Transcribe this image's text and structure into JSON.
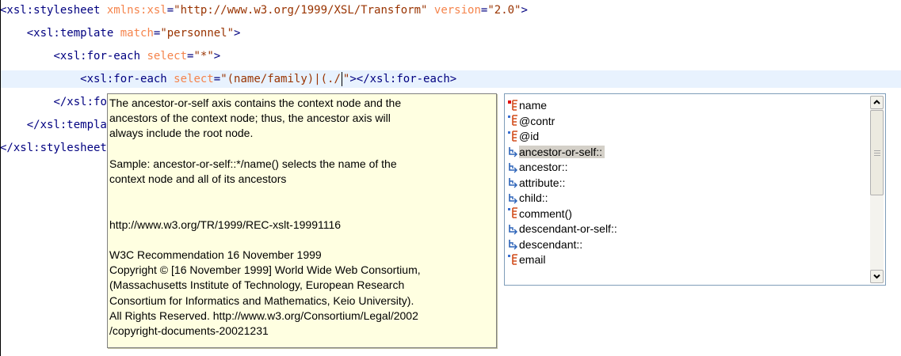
{
  "editor": {
    "lines": [
      {
        "indent": "",
        "tag_open": "<xsl:stylesheet",
        "attrs": [
          {
            "name": " xmlns:xsl",
            "value": "\"http://www.w3.org/1999/XSL/Transform\""
          },
          {
            "name": " version",
            "value": "\"2.0\""
          }
        ],
        "close": ">"
      },
      {
        "indent": "    ",
        "tag_open": "<xsl:template",
        "attrs": [
          {
            "name": " match",
            "value": "\"personnel\""
          }
        ],
        "close": ">"
      },
      {
        "indent": "        ",
        "tag_open": "<xsl:for-each",
        "attrs": [
          {
            "name": " select",
            "value": "\"*\""
          }
        ],
        "close": ">"
      },
      {
        "indent": "            ",
        "tag_open": "<xsl:for-each",
        "attrs": [
          {
            "name": " select",
            "value": "\"(name/family)|(./"
          }
        ],
        "after_caret": "\"",
        "close": "></xsl:for-each>",
        "current": true
      },
      {
        "indent": "        ",
        "tag_open": "</xsl:for-each>"
      },
      {
        "indent": "    ",
        "tag_open": "</xsl:template>"
      },
      {
        "indent": "",
        "tag_open": "</xsl:stylesheet>"
      }
    ]
  },
  "doc_popup": {
    "lines": [
      "The ancestor-or-self axis contains the context node and the",
      "ancestors of the context node; thus, the ancestor axis will",
      "always include the root node.",
      "",
      "Sample: ancestor-or-self::*/name() selects the name of the",
      "context node and all of its ancestors",
      "",
      "",
      "http://www.w3.org/TR/1999/REC-xslt-19991116",
      "",
      "W3C Recommendation 16 November 1999",
      "Copyright © [16 November 1999] World Wide Web Consortium,",
      "(Massachusetts Institute of Technology, European Research",
      "Consortium for Informatics and Mathematics, Keio University).",
      "All Rights Reserved. http://www.w3.org/Consortium/Legal/2002",
      "/copyright-documents-20021231"
    ]
  },
  "completion": {
    "items": [
      {
        "label": "name",
        "icon": "element-icon",
        "required": true
      },
      {
        "label": "@contr",
        "icon": "attribute-icon"
      },
      {
        "label": "@id",
        "icon": "attribute-icon"
      },
      {
        "label": "ancestor-or-self::",
        "icon": "axis-icon",
        "selected": true
      },
      {
        "label": "ancestor::",
        "icon": "axis-icon"
      },
      {
        "label": "attribute::",
        "icon": "axis-icon"
      },
      {
        "label": "child::",
        "icon": "axis-icon"
      },
      {
        "label": "comment()",
        "icon": "element-icon"
      },
      {
        "label": "descendant-or-self::",
        "icon": "axis-icon"
      },
      {
        "label": "descendant::",
        "icon": "axis-icon"
      },
      {
        "label": "email",
        "icon": "element-icon"
      }
    ]
  },
  "colors": {
    "tag": "#000080",
    "attr_name": "#f5844c",
    "attr_value": "#993300",
    "current_line": "#e8f2fe",
    "doc_bg": "#ffffe1",
    "selected_bg": "#d4d0c8",
    "element_icon": "#d24d1c",
    "axis_icon": "#2a62b8"
  }
}
